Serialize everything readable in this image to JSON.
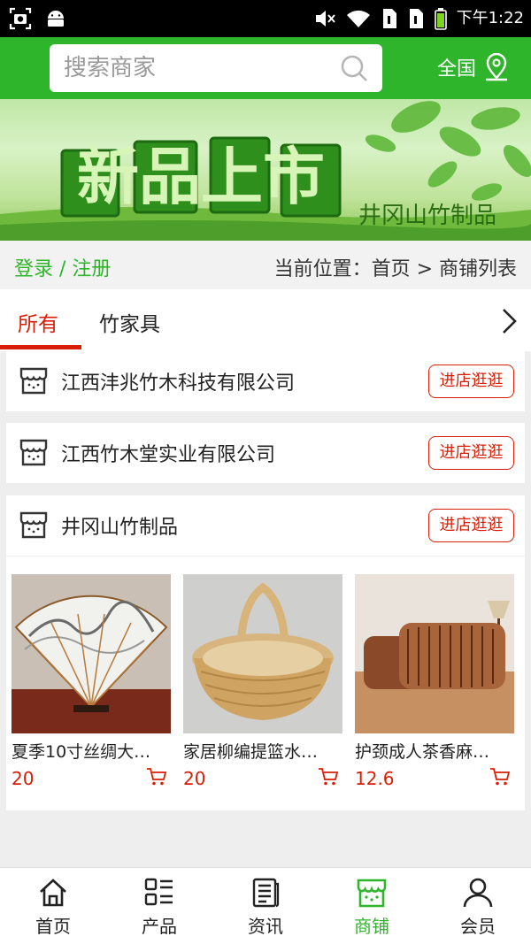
{
  "status_bar": {
    "time": "下午1:22"
  },
  "header": {
    "search_placeholder": "搜索商家",
    "region_label": "全国"
  },
  "banner": {
    "headline": "新品上市",
    "subtitle": "井冈山竹制品"
  },
  "location_bar": {
    "login_label": "登录 / 注册",
    "breadcrumb": "当前位置：首页 > 商铺列表"
  },
  "tabs": [
    {
      "label": "所有",
      "active": true
    },
    {
      "label": "竹家具",
      "active": false
    }
  ],
  "shops": [
    {
      "name": "江西沣兆竹木科技有限公司",
      "button": "进店逛逛"
    },
    {
      "name": "江西竹木堂实业有限公司",
      "button": "进店逛逛"
    },
    {
      "name": "井冈山竹制品",
      "button": "进店逛逛"
    }
  ],
  "products": [
    {
      "name": "夏季10寸丝绸大…",
      "price": "20"
    },
    {
      "name": "家居柳编提篮水…",
      "price": "20"
    },
    {
      "name": "护颈成人茶香麻…",
      "price": "12.6"
    }
  ],
  "bottom_nav": [
    {
      "label": "首页",
      "icon": "home-icon",
      "active": false
    },
    {
      "label": "产品",
      "icon": "grid-list-icon",
      "active": false
    },
    {
      "label": "资讯",
      "icon": "news-icon",
      "active": false
    },
    {
      "label": "商铺",
      "icon": "store-icon",
      "active": true
    },
    {
      "label": "会员",
      "icon": "user-icon",
      "active": false
    }
  ],
  "colors": {
    "brand_green": "#2fb52b",
    "accent_red": "#d81e06"
  }
}
